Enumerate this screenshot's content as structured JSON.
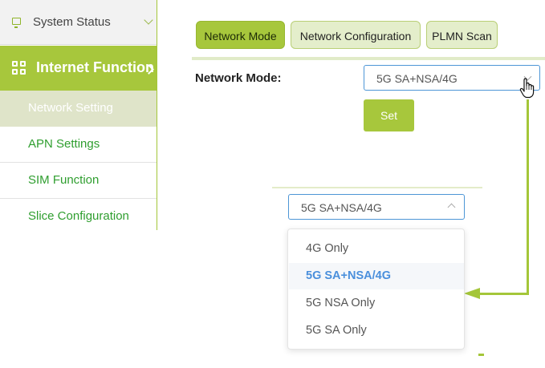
{
  "sidebar": {
    "system_status": {
      "label": "System Status",
      "icon": "monitor-icon"
    },
    "internet_function": {
      "label": "Internet Function",
      "icon": "grid-icon"
    },
    "items": [
      {
        "label": "Network Setting",
        "active": true
      },
      {
        "label": "APN Settings",
        "active": false
      },
      {
        "label": "SIM Function",
        "active": false
      },
      {
        "label": "Slice Configuration",
        "active": false
      }
    ]
  },
  "tabs": [
    {
      "label": "Network Mode",
      "active": true
    },
    {
      "label": "Network Configuration",
      "active": false
    },
    {
      "label": "PLMN Scan",
      "active": false
    }
  ],
  "form": {
    "network_mode_label": "Network Mode:",
    "network_mode_value": "5G SA+NSA/4G",
    "set_label": "Set"
  },
  "dropdown": {
    "value": "5G SA+NSA/4G",
    "options": [
      "4G Only",
      "5G SA+NSA/4G",
      "5G NSA Only",
      "5G SA Only"
    ],
    "selected": "5G SA+NSA/4G"
  },
  "colors": {
    "accent": "#a7c73c",
    "tab_inactive": "#e4eecb",
    "link_green": "#2f9e2f",
    "select_border": "#4d96d6",
    "option_selected": "#4a8fdc"
  }
}
